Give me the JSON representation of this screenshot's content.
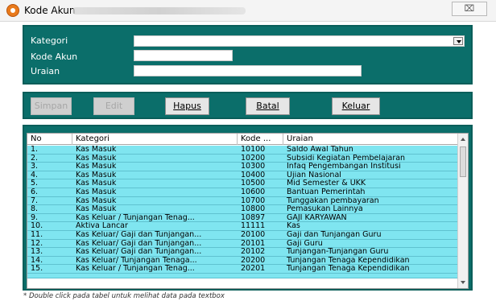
{
  "window": {
    "title": "Kode Akun",
    "close_glyph": "⌧",
    "icon": "app-icon"
  },
  "form": {
    "kategori_label": "Kategori",
    "kode_akun_label": "Kode Akun",
    "uraian_label": "Uraian",
    "kategori_value": "",
    "kode_akun_value": "",
    "uraian_value": ""
  },
  "buttons": [
    {
      "label": "Simpan",
      "enabled": false
    },
    {
      "label": "Edit",
      "enabled": false
    },
    {
      "label": "Hapus",
      "enabled": true
    },
    {
      "label": "Batal",
      "enabled": true
    },
    {
      "label": "Keluar",
      "enabled": true
    }
  ],
  "table": {
    "headers": [
      "No",
      "Kategori",
      "Kode ...",
      "Uraian"
    ],
    "rows": [
      [
        "1.",
        "Kas Masuk",
        "10100",
        "Saldo Awal Tahun"
      ],
      [
        "2.",
        "Kas Masuk",
        "10200",
        "Subsidi Kegiatan Pembelajaran"
      ],
      [
        "3.",
        "Kas Masuk",
        "10300",
        "Infaq Pengembangan Institusi"
      ],
      [
        "4.",
        "Kas Masuk",
        "10400",
        "Ujian Nasional"
      ],
      [
        "5.",
        "Kas Masuk",
        "10500",
        "Mid Semester & UKK"
      ],
      [
        "6.",
        "Kas Masuk",
        "10600",
        "Bantuan Pemerintah"
      ],
      [
        "7.",
        "Kas Masuk",
        "10700",
        "Tunggakan pembayaran"
      ],
      [
        "8.",
        "Kas Masuk",
        "10800",
        "Pemasukan Lainnya"
      ],
      [
        "9.",
        "Kas Keluar / Tunjangan Tenag...",
        "10897",
        "GAJI KARYAWAN"
      ],
      [
        "10.",
        "Aktiva Lancar",
        "11111",
        "Kas"
      ],
      [
        "11.",
        "Kas Keluar/ Gaji dan Tunjangan...",
        "20100",
        "Gaji dan Tunjangan Guru"
      ],
      [
        "12.",
        "Kas Keluar/ Gaji dan Tunjangan...",
        "20101",
        "Gaji Guru"
      ],
      [
        "13.",
        "Kas Keluar/ Gaji dan Tunjangan...",
        "20102",
        "Tunjangan-Tunjangan Guru"
      ],
      [
        "14.",
        "Kas Keluar/ Tunjangan Tenaga...",
        "20200",
        "Tunjangan Tenaga Kependidikan"
      ],
      [
        "15.",
        "Kas Keluar / Tunjangan Tenag...",
        "20201",
        "Tunjangan Tenaga Kependidikan"
      ]
    ]
  },
  "footnote": "* Double click pada tabel untuk melihat data pada textbox",
  "colors": {
    "panel": "#0b6e6a",
    "row": "#7fe5f0"
  }
}
